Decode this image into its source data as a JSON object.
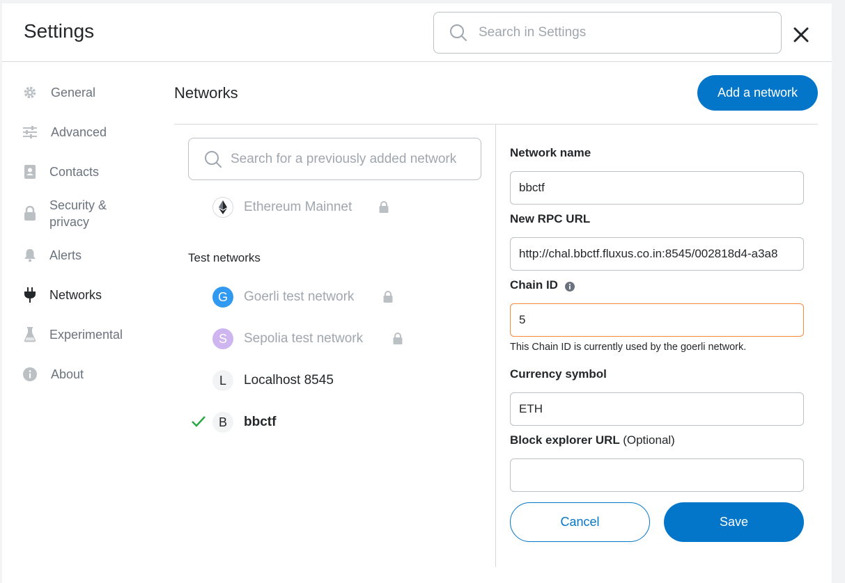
{
  "header": {
    "title": "Settings",
    "search_placeholder": "Search in Settings"
  },
  "sidebar": {
    "items": [
      {
        "label": "General",
        "icon": "gear-icon"
      },
      {
        "label": "Advanced",
        "icon": "sliders-icon"
      },
      {
        "label": "Contacts",
        "icon": "contact-book-icon"
      },
      {
        "label": "Security &",
        "label2": "privacy",
        "icon": "lock-icon"
      },
      {
        "label": "Alerts",
        "icon": "bell-icon"
      },
      {
        "label": "Networks",
        "icon": "plug-icon"
      },
      {
        "label": "Experimental",
        "icon": "flask-icon"
      },
      {
        "label": "About",
        "icon": "info-icon"
      }
    ]
  },
  "main": {
    "title": "Networks",
    "add_button": "Add a network",
    "network_search_placeholder": "Search for a previously added network",
    "networks": [
      {
        "name": "Ethereum Mainnet",
        "icon": "ethereum-icon",
        "locked": true
      },
      {
        "name": "Goerli test network",
        "initial": "G",
        "locked": true
      },
      {
        "name": "Sepolia test network",
        "initial": "S",
        "locked": true
      },
      {
        "name": "Localhost 8545",
        "initial": "L",
        "locked": false
      },
      {
        "name": "bbctf",
        "initial": "B",
        "locked": false,
        "selected": true
      }
    ],
    "test_networks_label": "Test networks"
  },
  "form": {
    "network_name_label": "Network name",
    "network_name_value": "bbctf",
    "rpc_label": "New RPC URL",
    "rpc_value": "http://chal.bbctf.fluxus.co.in:8545/002818d4-a3a8",
    "chain_id_label": "Chain ID",
    "chain_id_value": "5",
    "chain_id_warning": "This Chain ID is currently used by the goerli network.",
    "currency_label": "Currency symbol",
    "currency_value": "ETH",
    "explorer_label": "Block explorer URL",
    "explorer_optional": "(Optional)",
    "explorer_value": "",
    "cancel_label": "Cancel",
    "save_label": "Save"
  },
  "colors": {
    "accent": "#0376c9",
    "warning_border": "#f8883b",
    "success_check": "#28a745",
    "goerli": "#3099f2",
    "sepolia": "#cfb5f0"
  }
}
